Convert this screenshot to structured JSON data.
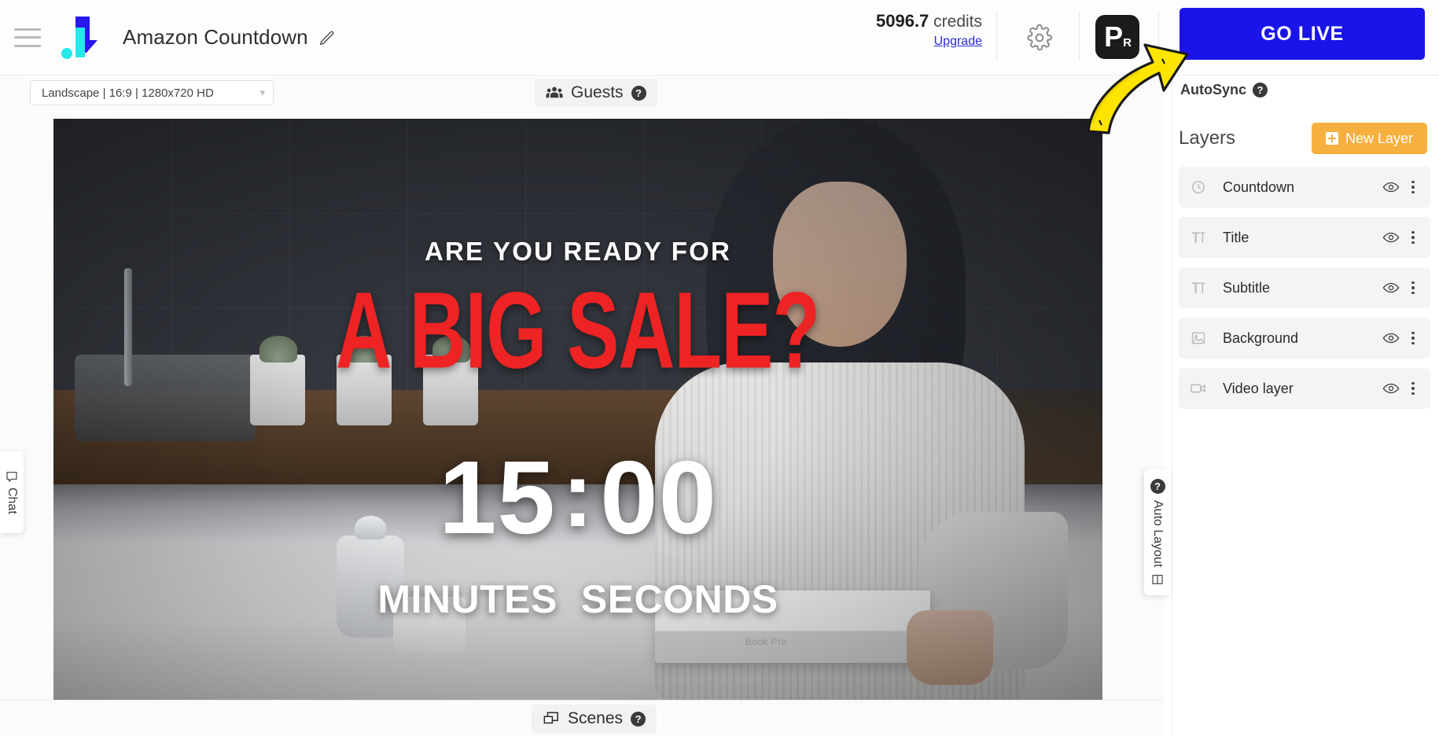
{
  "topbar": {
    "menu_icon": "hamburger-icon",
    "logo_icon": "app-logo",
    "project_title": "Amazon Countdown",
    "edit_icon": "pencil-icon",
    "credits_value": "5096.7",
    "credits_label": "credits",
    "upgrade_label": "Upgrade",
    "settings_icon": "gear-icon",
    "avatar_initial": "P",
    "avatar_sub": "R",
    "go_live_label": "GO LIVE",
    "go_live_color": "#1a14e8"
  },
  "subbar": {
    "format_value": "Landscape | 16:9 | 1280x720 HD",
    "caret_icon": "chevron-down-icon",
    "guests_label": "Guests",
    "guests_icon": "people-icon",
    "guests_help": "?"
  },
  "canvas": {
    "subtitle_text": "ARE YOU READY FOR",
    "title_text": "A BIG SALE?",
    "title_color": "#ee2324",
    "countdown_minutes": "15",
    "countdown_colon": ":",
    "countdown_seconds": "00",
    "unit_minutes": "MINUTES",
    "unit_seconds": "SECONDS",
    "box_label": "Book Pro"
  },
  "chat_tab": {
    "label": "Chat",
    "icon": "chat-bubble-icon"
  },
  "auto_layout_tab": {
    "label": "Auto Layout",
    "help": "?",
    "icon": "layout-grid-icon"
  },
  "bottombar": {
    "scenes_label": "Scenes",
    "scenes_icon": "scenes-icon",
    "scenes_help": "?"
  },
  "sidebar": {
    "autosync_label": "AutoSync",
    "autosync_help": "?",
    "layers_title": "Layers",
    "new_layer_label": "New Layer",
    "new_layer_color": "#f6b040",
    "layers": [
      {
        "name": "Countdown",
        "icon": "clock-icon",
        "visible_icon": "eye-icon",
        "menu_icon": "more-vertical-icon"
      },
      {
        "name": "Title",
        "icon": "text-icon",
        "visible_icon": "eye-icon",
        "menu_icon": "more-vertical-icon"
      },
      {
        "name": "Subtitle",
        "icon": "text-icon",
        "visible_icon": "eye-icon",
        "menu_icon": "more-vertical-icon"
      },
      {
        "name": "Background",
        "icon": "image-icon",
        "visible_icon": "eye-icon",
        "menu_icon": "more-vertical-icon"
      },
      {
        "name": "Video layer",
        "icon": "video-icon",
        "visible_icon": "eye-icon",
        "menu_icon": "more-vertical-icon"
      }
    ]
  },
  "annotation": {
    "arrow_icon": "yellow-curved-arrow",
    "arrow_color": "#ffe400"
  }
}
